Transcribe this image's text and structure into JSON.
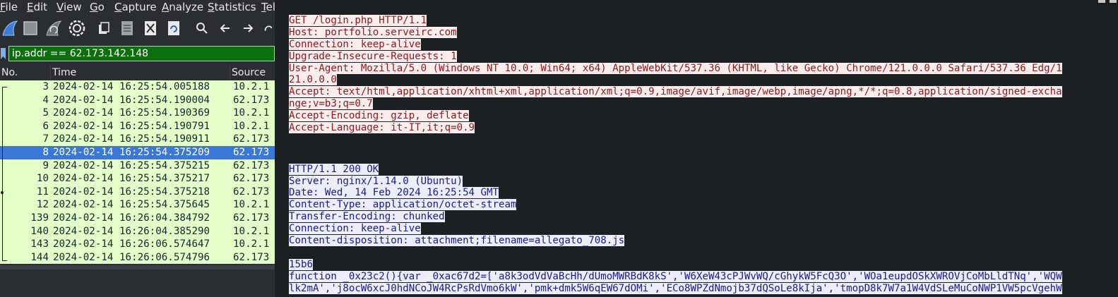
{
  "menu": [
    {
      "label": "File",
      "key": "F",
      "rest": "ile"
    },
    {
      "label": "Edit",
      "key": "E",
      "rest": "dit"
    },
    {
      "label": "View",
      "key": "V",
      "rest": "iew"
    },
    {
      "label": "Go",
      "key": "G",
      "rest": "o"
    },
    {
      "label": "Capture",
      "key": "C",
      "rest": "apture"
    },
    {
      "label": "Analyze",
      "key": "A",
      "rest": "nalyze"
    },
    {
      "label": "Statistics",
      "key": "S",
      "rest": "tatistics"
    },
    {
      "label": "Tel",
      "key": "T",
      "rest": "el"
    }
  ],
  "toolbar": {
    "icons": [
      "shark-fin-start-icon",
      "stop-square-icon",
      "restart-shark-icon",
      "capture-options-gear-icon",
      "open-file-icon",
      "save-file-icon",
      "close-file-icon",
      "reload-file-icon",
      "search-icon",
      "back-arrow-icon",
      "forward-arrow-icon",
      "jump-icon"
    ]
  },
  "filter": {
    "value": "ip.addr == 62.173.142.148"
  },
  "packet_list": {
    "columns": [
      "No.",
      "Time",
      "Source"
    ],
    "rows": [
      {
        "no": "3",
        "time": "2024-02-14 16:25:54.005188",
        "src": "10.2.1",
        "selected": false
      },
      {
        "no": "4",
        "time": "2024-02-14 16:25:54.190004",
        "src": "62.173",
        "selected": false
      },
      {
        "no": "5",
        "time": "2024-02-14 16:25:54.190369",
        "src": "10.2.1",
        "selected": false
      },
      {
        "no": "6",
        "time": "2024-02-14 16:25:54.190791",
        "src": "10.2.1",
        "selected": false
      },
      {
        "no": "7",
        "time": "2024-02-14 16:25:54.190911",
        "src": "62.173",
        "selected": false
      },
      {
        "no": "8",
        "time": "2024-02-14 16:25:54.375209",
        "src": "62.173",
        "selected": true
      },
      {
        "no": "9",
        "time": "2024-02-14 16:25:54.375215",
        "src": "62.173",
        "selected": false
      },
      {
        "no": "10",
        "time": "2024-02-14 16:25:54.375217",
        "src": "62.173",
        "selected": false
      },
      {
        "no": "11",
        "time": "2024-02-14 16:25:54.375218",
        "src": "62.173",
        "selected": false
      },
      {
        "no": "12",
        "time": "2024-02-14 16:25:54.375645",
        "src": "10.2.1",
        "selected": false
      },
      {
        "no": "139",
        "time": "2024-02-14 16:26:04.384792",
        "src": "62.173",
        "selected": false
      },
      {
        "no": "140",
        "time": "2024-02-14 16:26:04.385290",
        "src": "10.2.1",
        "selected": false
      },
      {
        "no": "143",
        "time": "2024-02-14 16:26:06.574647",
        "src": "10.2.1",
        "selected": false
      },
      {
        "no": "144",
        "time": "2024-02-14 16:26:06.574796",
        "src": "62.173",
        "selected": false
      }
    ]
  },
  "stream": {
    "request": [
      "GET /login.php HTTP/1.1",
      "Host: portfolio.serveirc.com",
      "Connection: keep-alive",
      "Upgrade-Insecure-Requests: 1",
      "User-Agent: Mozilla/5.0 (Windows NT 10.0; Win64; x64) AppleWebKit/537.36 (KHTML, like Gecko) Chrome/121.0.0.0 Safari/537.36 Edg/1",
      "21.0.0.0",
      "Accept: text/html,application/xhtml+xml,application/xml;q=0.9,image/avif,image/webp,image/apng,*/*;q=0.8,application/signed-excha",
      "nge;v=b3;q=0.7",
      "Accept-Encoding: gzip, deflate",
      "Accept-Language: it-IT,it;q=0.9"
    ],
    "response": [
      "HTTP/1.1 200 OK",
      "Server: nginx/1.14.0 (Ubuntu)",
      "Date: Wed, 14 Feb 2024 16:25:54 GMT",
      "Content-Type: application/octet-stream",
      "Transfer-Encoding: chunked",
      "Connection: keep-alive",
      "Content-disposition: attachment;filename=allegato_708.js"
    ],
    "body": [
      "15b6",
      "function _0x23c2(){var _0xac67d2=['a8k3odVdVaBcHh/dUmoMWRBdK8kS','W6XeW43cPJWvWQ/cGhykW5FcQ3O','WOa1eupdOSkXWROVjCoMbLldTNq','WQW",
      "lk2mA','j8ocW6xcJ0hdNCoJW4RcPsRdVmo6kW','pmk+dmk5W6qEW67dOMi','ECo8WPZdNmojb37dQSoLe8kIja','tmopD8k7W7a1W4VdSLeMuCoNWP1VW5pcVgehW"
    ]
  },
  "colors": {
    "client_text": "#8b1a1a",
    "client_bg": "#fbeded",
    "server_text": "#1a1a8b",
    "server_bg": "#ededfb",
    "packet_row_bg": "#e4ffc7",
    "selected_row_bg": "#3a78d8",
    "filter_valid_bg": "#0c6e0c"
  }
}
